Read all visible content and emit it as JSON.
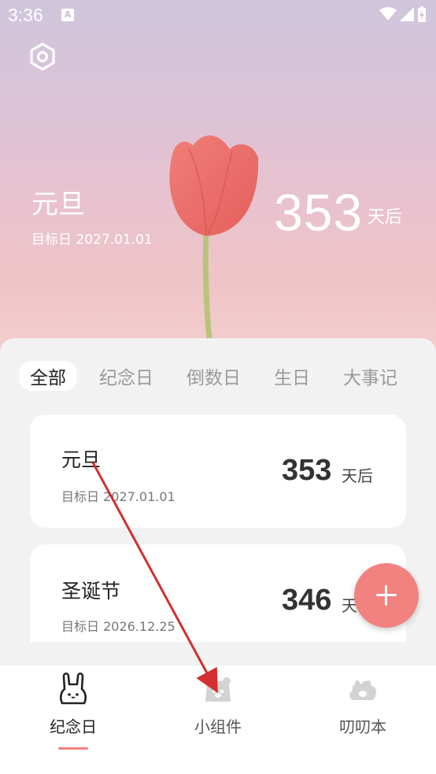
{
  "status_bar": {
    "time": "3:36",
    "notification_glyph": "A"
  },
  "hero": {
    "title": "元旦",
    "date": "目标日 2027.01.01",
    "days": "353",
    "unit": "天后"
  },
  "tabs": [
    {
      "label": "全部",
      "active": true
    },
    {
      "label": "纪念日",
      "active": false
    },
    {
      "label": "倒数日",
      "active": false
    },
    {
      "label": "生日",
      "active": false
    },
    {
      "label": "大事记",
      "active": false
    }
  ],
  "cards": [
    {
      "title": "元旦",
      "date": "目标日 2027.01.01",
      "days": "353",
      "unit": "天后"
    },
    {
      "title": "圣诞节",
      "date": "目标日 2026.12.25",
      "days": "346",
      "unit": "天"
    }
  ],
  "bottom_nav": [
    {
      "label": "纪念日",
      "icon": "bunny-icon",
      "active": true
    },
    {
      "label": "小组件",
      "icon": "bear-widget-icon",
      "active": false
    },
    {
      "label": "叨叨本",
      "icon": "paw-cloud-icon",
      "active": false
    }
  ],
  "colors": {
    "accent": "#f1827f",
    "annotation_arrow": "#d32f2f"
  }
}
